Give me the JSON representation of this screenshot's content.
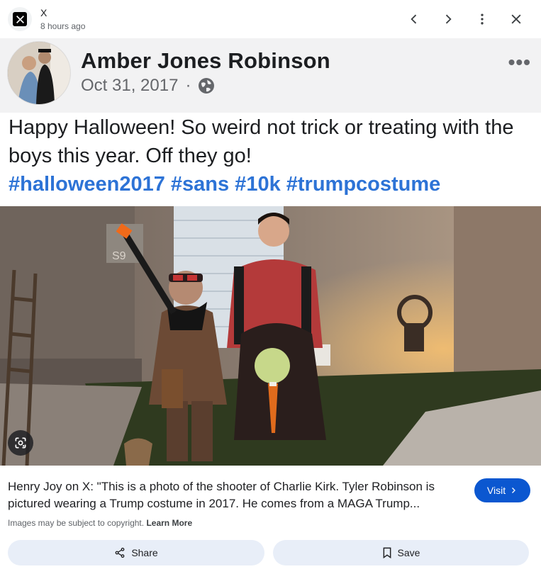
{
  "topbar": {
    "source_name": "X",
    "source_time": "8 hours ago",
    "icons": [
      "x-logo-icon",
      "chevron-left-icon",
      "chevron-right-icon",
      "more-vert-icon",
      "close-icon"
    ]
  },
  "post": {
    "author": "Amber Jones Robinson",
    "date": "Oct 31, 2017",
    "separator": "·",
    "more": "•••",
    "text": "Happy Halloween! So weird not trick or treating with the boys this year. Off they go!",
    "hashtags": "#halloween2017 #sans #10k #trumpcostume",
    "house_number": "S9"
  },
  "result": {
    "caption": "Henry Joy on X: \"This is a photo of the shooter of Charlie Kirk. Tyler Robinson is pictured wearing a Trump costume in 2017. He comes from a MAGA Trump...",
    "visit_label": "Visit",
    "copyright_text": "Images may be subject to copyright.",
    "learn_more": "Learn More",
    "share_label": "Share",
    "save_label": "Save"
  },
  "colors": {
    "accent": "#0b57d0",
    "hashtag": "#2d73d6",
    "action_bg": "#e8eef8"
  }
}
